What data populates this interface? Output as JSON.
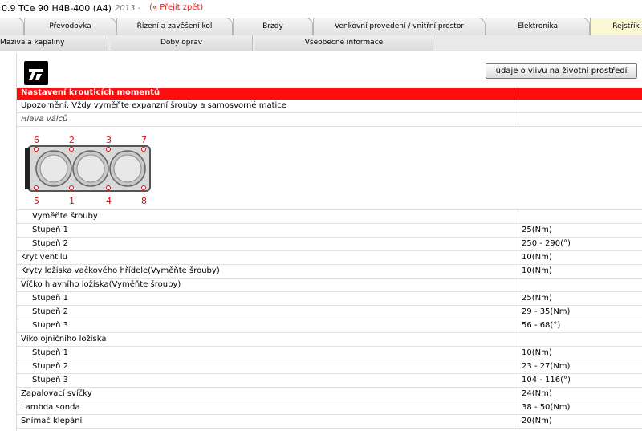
{
  "header": {
    "model": "0.9 TCe 90 H4B-400 (A4)",
    "year": "2013 -",
    "back_link": "(« Přejít zpět)"
  },
  "tabs": [
    "Převodovka",
    "Řízení a zavěšení kol",
    "Brzdy",
    "Venkovní provedení / vnitřní prostor",
    "Elektronika",
    "Rejstřík"
  ],
  "subtabs": [
    "Maziva a kapaliny",
    "Doby oprav",
    "Všeobecné informace"
  ],
  "env_button": "údaje o vlivu na životní prostředí",
  "section_title": "Nastavení krouticích momentů",
  "notice": "Upozornění: Vždy vyměňte expanzní šrouby a samosvorné matice",
  "subtitle": "Hlava válců",
  "diagram_labels": {
    "top": [
      "6",
      "2",
      "3",
      "7"
    ],
    "bottom": [
      "5",
      "1",
      "4",
      "8"
    ]
  },
  "rows": [
    {
      "label": "Vyměňte šrouby",
      "value": "",
      "indent": true
    },
    {
      "label": "Stupeň 1",
      "value": "25(Nm)",
      "indent": true
    },
    {
      "label": "Stupeň 2",
      "value": "250 - 290(°)",
      "indent": true
    },
    {
      "label": "Kryt ventilu",
      "value": "10(Nm)",
      "indent": false
    },
    {
      "label": "Kryty ložiska vačkového hřídele(Vyměňte šrouby)",
      "value": "10(Nm)",
      "indent": false
    },
    {
      "label": "Víčko hlavního ložiska(Vyměňte šrouby)",
      "value": "",
      "indent": false
    },
    {
      "label": "Stupeň 1",
      "value": "25(Nm)",
      "indent": true
    },
    {
      "label": "Stupeň 2",
      "value": "29 - 35(Nm)",
      "indent": true
    },
    {
      "label": "Stupeň 3",
      "value": "56 - 68(°)",
      "indent": true
    },
    {
      "label": "Víko ojničního ložiska",
      "value": "",
      "indent": false
    },
    {
      "label": "Stupeň 1",
      "value": "10(Nm)",
      "indent": true
    },
    {
      "label": "Stupeň 2",
      "value": "23 - 27(Nm)",
      "indent": true
    },
    {
      "label": "Stupeň 3",
      "value": "104 - 116(°)",
      "indent": true
    },
    {
      "label": "Zapalovací svíčky",
      "value": "24(Nm)",
      "indent": false
    },
    {
      "label": "Lambda sonda",
      "value": "38 - 50(Nm)",
      "indent": false
    },
    {
      "label": "Snímač klepání",
      "value": "20(Nm)",
      "indent": false
    }
  ],
  "colors": {
    "accent_red": "#ff0d0d",
    "active_tab": "#fbf8d4",
    "link_red": "#e0201a"
  }
}
